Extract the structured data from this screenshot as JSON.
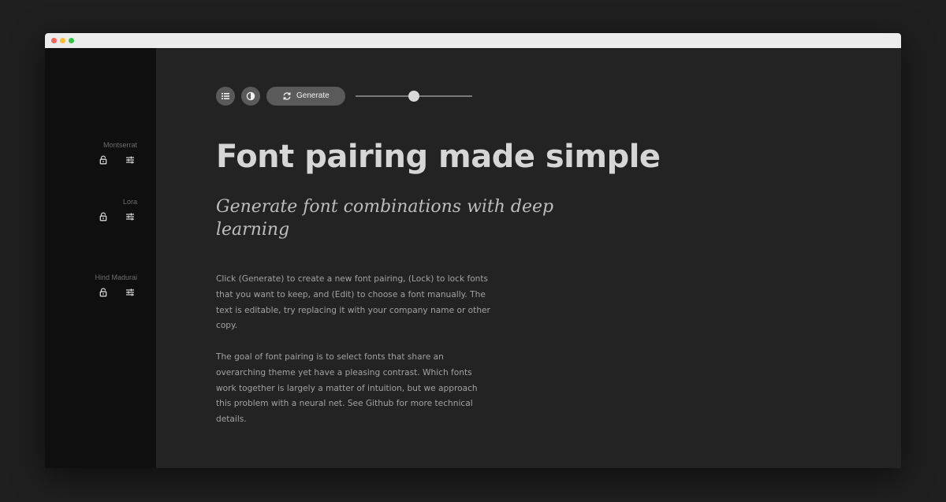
{
  "window": {
    "controls": [
      "close",
      "minimize",
      "maximize"
    ]
  },
  "sidebar": {
    "fonts": [
      {
        "name": "Montserrat",
        "lock_icon": "lock-icon",
        "edit_icon": "sliders-icon"
      },
      {
        "name": "Lora",
        "lock_icon": "lock-icon",
        "edit_icon": "sliders-icon"
      },
      {
        "name": "Hind Madurai",
        "lock_icon": "lock-icon",
        "edit_icon": "sliders-icon"
      }
    ]
  },
  "toolbar": {
    "list_icon": "list-icon",
    "contrast_icon": "contrast-icon",
    "generate_icon": "refresh-icon",
    "generate_label": "Generate",
    "slider_value": 0.5
  },
  "content": {
    "headline": "Font pairing made simple",
    "subheadline": "Generate font combinations with deep learning",
    "paragraph_1": "Click (Generate) to create a new font pairing, (Lock) to lock fonts that you want to keep, and (Edit) to choose a font manually. The text is editable, try replacing it with your company name or other copy.",
    "paragraph_2": "The goal of font pairing is to select fonts that share an overarching theme yet have a pleasing contrast. Which fonts work together is largely a matter of intuition, but we approach this problem with a neural net. See Github for more technical details."
  },
  "colors": {
    "page_background": "#1f1f1f",
    "sidebar_background": "#0f0f0f",
    "main_background": "#232323",
    "button_background": "#5a5a5a",
    "close_dot": "#fb5f57",
    "minimize_dot": "#fdbc2e",
    "maximize_dot": "#28c840"
  }
}
